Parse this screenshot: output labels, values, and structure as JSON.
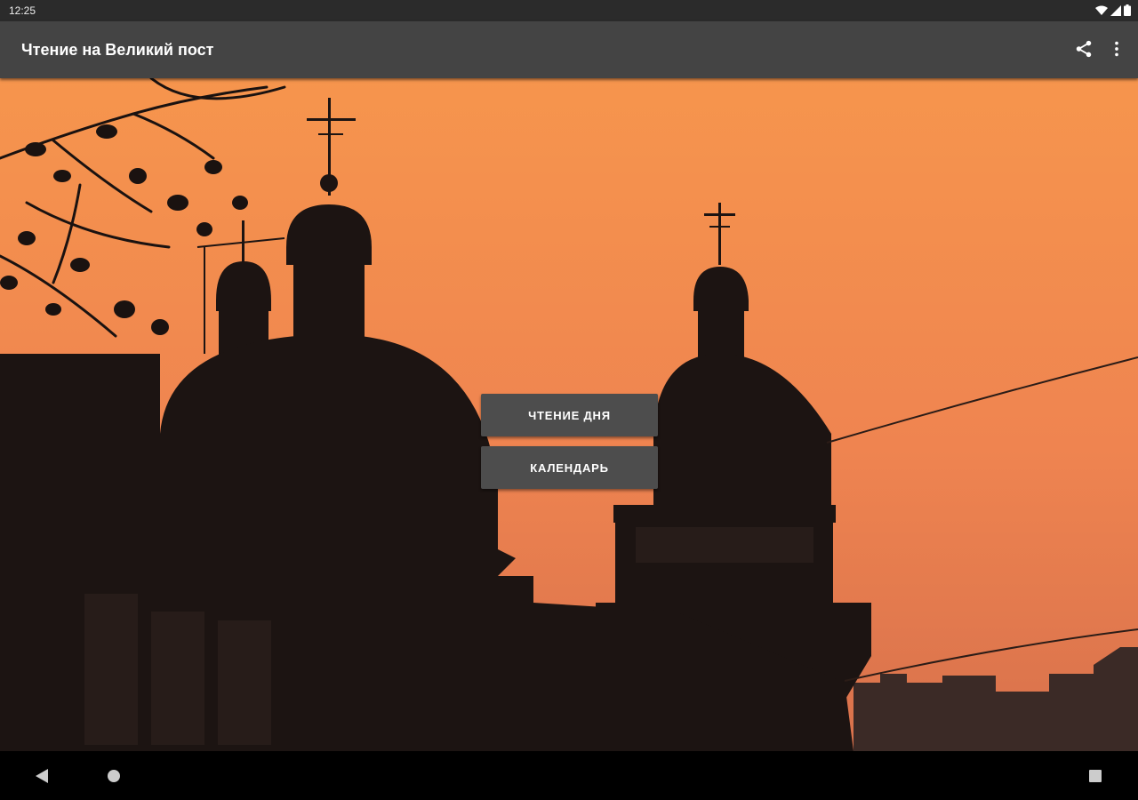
{
  "status_bar": {
    "time": "12:25",
    "icons": [
      "wifi-icon",
      "signal-icon",
      "battery-icon"
    ]
  },
  "app_bar": {
    "title": "Чтение на Великий пост",
    "actions": [
      "share-icon",
      "overflow-menu-icon"
    ]
  },
  "background": {
    "description_icon": "church-silhouette-sunset",
    "sky_top_color": "#f4934c",
    "sky_bottom_color": "#e2764a",
    "silhouette_color": "#1c1412"
  },
  "buttons": {
    "reading_label": "ЧТЕНИЕ ДНЯ",
    "calendar_label": "КАЛЕНДАРЬ"
  },
  "nav_bar": {
    "icons": [
      "back-icon",
      "home-icon",
      "recents-icon"
    ]
  }
}
